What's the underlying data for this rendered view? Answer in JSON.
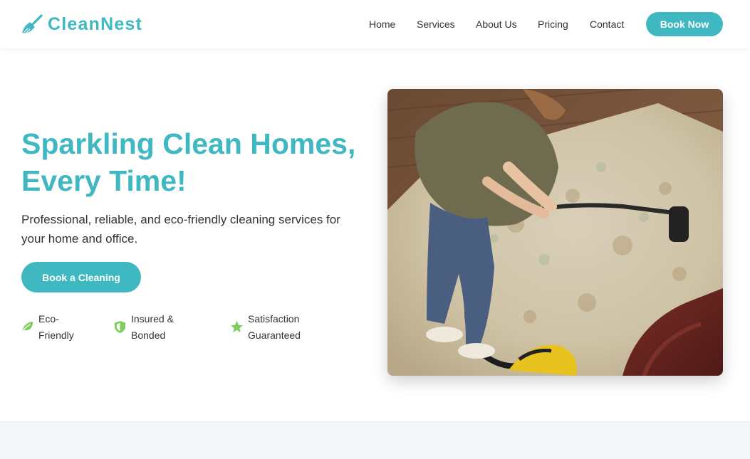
{
  "brand": {
    "name": "CleanNest",
    "icon": "broom-icon",
    "color": "#3fb8c1"
  },
  "nav": {
    "items": [
      {
        "label": "Home"
      },
      {
        "label": "Services"
      },
      {
        "label": "About Us"
      },
      {
        "label": "Pricing"
      },
      {
        "label": "Contact"
      }
    ],
    "cta_label": "Book Now"
  },
  "hero": {
    "title_line1": "Sparkling Clean Homes,",
    "title_line2": "Every Time!",
    "subtitle": "Professional, reliable, and eco-friendly cleaning services for your home and office.",
    "cta_label": "Book a Cleaning",
    "image_icon": "vacuum-cleaning-photo",
    "features": [
      {
        "label": "Eco-Friendly",
        "icon": "leaf-icon"
      },
      {
        "label": "Insured & Bonded",
        "icon": "shield-icon"
      },
      {
        "label": "Satisfaction Guaranteed",
        "icon": "star-icon"
      }
    ]
  },
  "colors": {
    "accent": "#3fb8c1",
    "feature_icon": "#7ccf5c",
    "text": "#333333"
  }
}
